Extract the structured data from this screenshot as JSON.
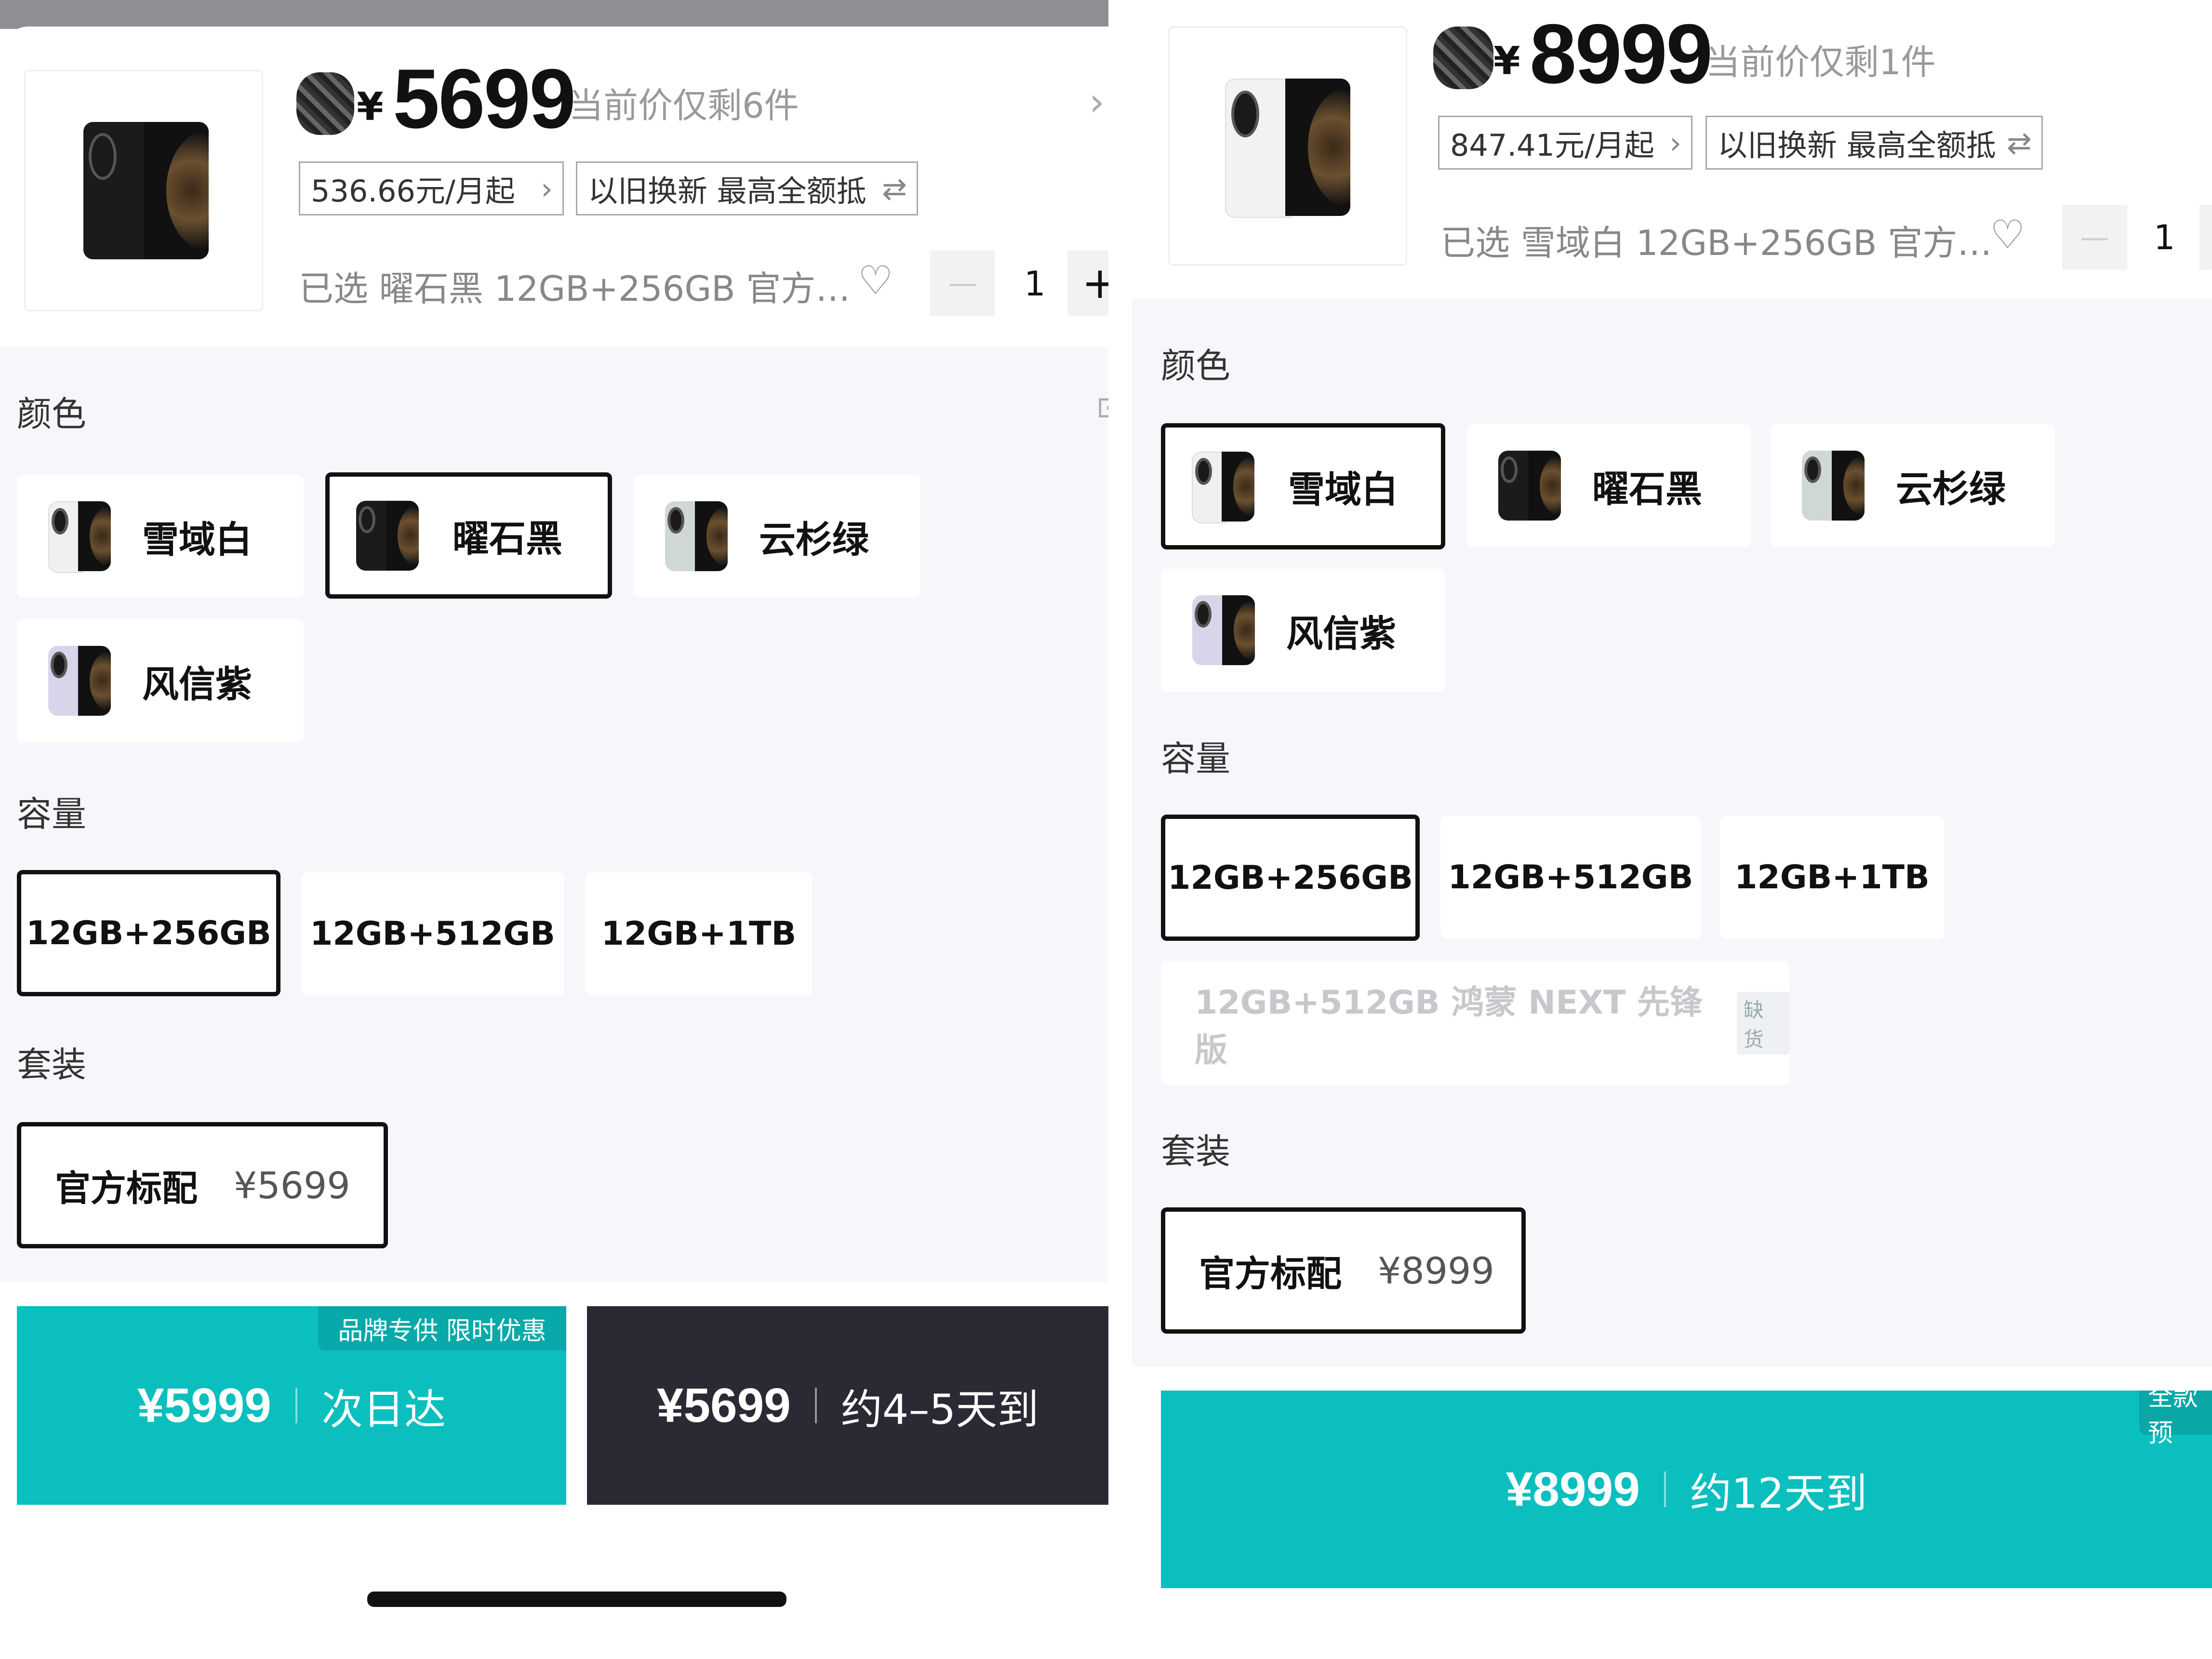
{
  "colors": {
    "teal": "#0bbfbf",
    "dark": "#2b2a34",
    "option_bg": "#f7f7fb"
  },
  "left": {
    "currency": "¥",
    "price": "5699",
    "stock_note": "当前价仅剩6件",
    "installment": "536.66元/月起",
    "trade_in": "以旧换新 最高全额抵",
    "selected": "已选 曜石黑 12GB+256GB 官方…",
    "qty_minus": "—",
    "qty": "1",
    "qty_plus": "+",
    "color_title": "颜色",
    "colors": [
      "雪域白",
      "曜石黑",
      "云杉绿",
      "风信紫"
    ],
    "capacity_title": "容量",
    "capacities": [
      "12GB+256GB",
      "12GB+512GB",
      "12GB+1TB"
    ],
    "bundle_title": "套装",
    "bundle_name": "官方标配",
    "bundle_price": "¥5699",
    "buy1_tag": "品牌专供 限时优惠",
    "buy1_price": "¥5999",
    "buy1_eta": "次日达",
    "buy2_price": "¥5699",
    "buy2_eta": "约4–5天到"
  },
  "right": {
    "currency": "¥",
    "price": "8999",
    "stock_note": "当前价仅剩1件",
    "installment": "847.41元/月起",
    "trade_in": "以旧换新 最高全额抵",
    "selected": "已选 雪域白 12GB+256GB 官方…",
    "qty_minus": "—",
    "qty": "1",
    "color_title": "颜色",
    "colors": [
      "雪域白",
      "曜石黑",
      "云杉绿",
      "风信紫"
    ],
    "capacity_title": "容量",
    "capacities": [
      "12GB+256GB",
      "12GB+512GB",
      "12GB+1TB"
    ],
    "capacity_disabled": "12GB+512GB 鸿蒙 NEXT 先锋版",
    "out_of_stock": "缺货",
    "bundle_title": "套装",
    "bundle_name": "官方标配",
    "bundle_price": "¥8999",
    "buy_tag": "全款预",
    "buy_price": "¥8999",
    "buy_eta": "约12天到"
  }
}
